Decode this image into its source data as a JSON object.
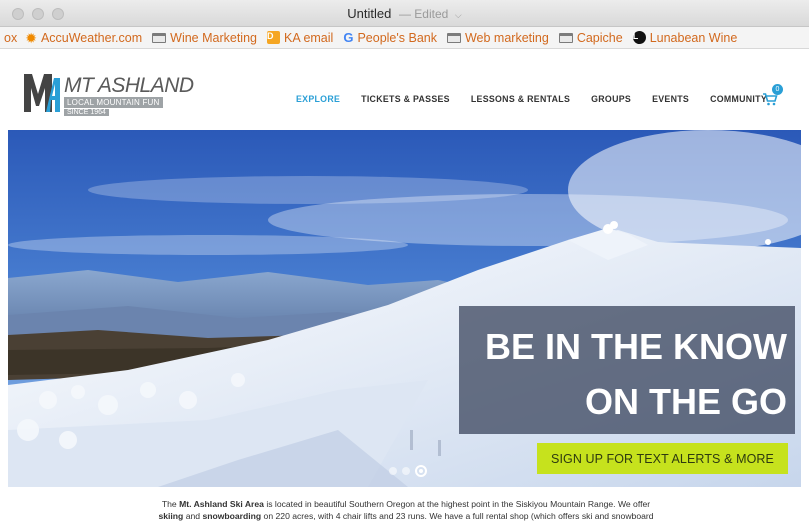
{
  "window": {
    "title": "Untitled",
    "status": "— Edited",
    "chevron": "⌵"
  },
  "bookmarks": [
    {
      "label": "ox",
      "icon": "none"
    },
    {
      "label": "AccuWeather.com",
      "icon": "sun-icon"
    },
    {
      "label": "Wine Marketing",
      "icon": "folder-icon"
    },
    {
      "label": "KA email",
      "icon": "app-icon"
    },
    {
      "label": "People's Bank",
      "icon": "google-icon"
    },
    {
      "label": "Web marketing",
      "icon": "folder-icon"
    },
    {
      "label": "Capiche",
      "icon": "folder-icon"
    },
    {
      "label": "Lunabean Wine",
      "icon": "circle-icon"
    }
  ],
  "site": {
    "logo": {
      "mark": "MtA",
      "title": "MT ASHLAND",
      "subtitle": "LOCAL MOUNTAIN FUN",
      "since": "SINCE 1964"
    },
    "nav": {
      "explore": "EXPLORE",
      "tickets": "TICKETS & PASSES",
      "lessons": "LESSONS & RENTALS",
      "groups": "GROUPS",
      "events": "EVENTS",
      "community": "COMMUNITY"
    },
    "cart": {
      "count": "0"
    }
  },
  "hero": {
    "headline_line1": "BE IN THE KNOW",
    "headline_line2": "ON THE GO",
    "cta": "SIGN UP FOR TEXT ALERTS & MORE",
    "slides": 3,
    "active_slide": 3
  },
  "intro": {
    "p1": "The ",
    "b1": "Mt. Ashland Ski Area",
    "p2": " is located in beautiful Southern Oregon at the highest point in the Siskiyou Mountain Range. We offer",
    "b2": "skiing",
    "p3": " and ",
    "b3": "snowboarding",
    "p4": " on 220 acres, with 4 chair lifts and 23 runs. We have a full rental shop (which offers ski and snowboard"
  },
  "colors": {
    "accent": "#2a9fd6",
    "cta": "#c6e21d",
    "bookmark_text": "#d2691e"
  }
}
